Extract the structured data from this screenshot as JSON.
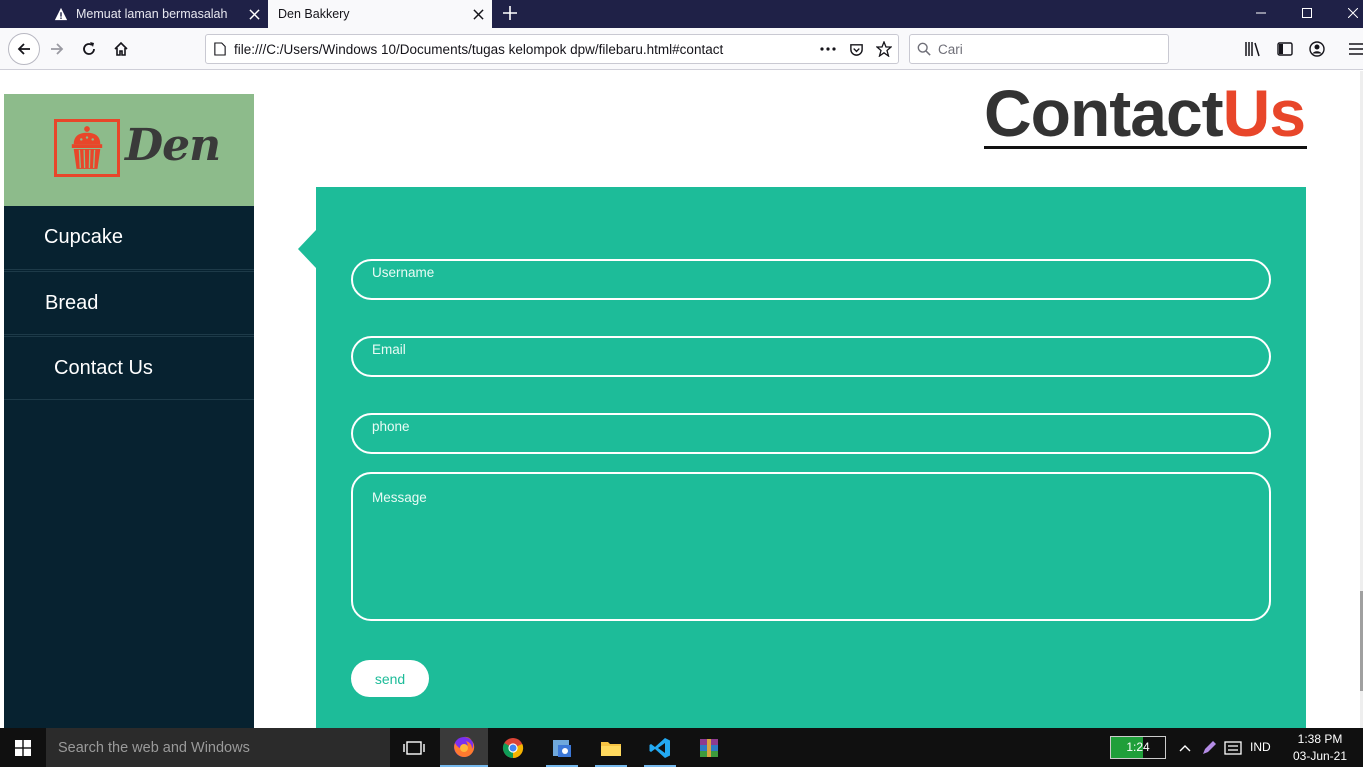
{
  "browser": {
    "tabs": [
      {
        "title": "Memuat laman bermasalah",
        "icon": "warning-icon"
      },
      {
        "title": "Den Bakkery",
        "active": true
      }
    ],
    "url": "file:///C:/Users/Windows 10/Documents/tugas kelompok dpw/filebaru.html#contact",
    "search_placeholder": "Cari"
  },
  "page": {
    "logo_text": "Den",
    "sidebar_items": [
      {
        "label": "Cupcake"
      },
      {
        "label": "Bread"
      },
      {
        "label": "Contact Us"
      }
    ],
    "heading_main": "Contact",
    "heading_accent": "Us",
    "form": {
      "username_placeholder": "Username",
      "email_placeholder": "Email",
      "phone_placeholder": "phone",
      "message_placeholder": "Message",
      "send_label": "send"
    },
    "colors": {
      "panel": "#1dbc99",
      "sidebar": "#072230",
      "logo_bg": "#8dbb8b",
      "accent": "#e8462a"
    }
  },
  "taskbar": {
    "search_placeholder": "Search the web and Windows",
    "battery_text": "1:24",
    "battery_level": 0.6,
    "language": "IND",
    "time": "1:38 PM",
    "date": "03-Jun-21"
  }
}
